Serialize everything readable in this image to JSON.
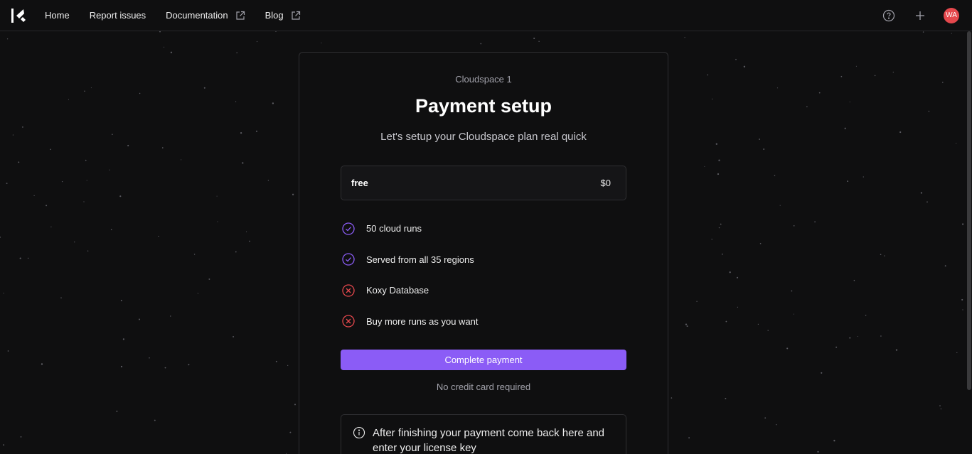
{
  "nav": {
    "logo": "koxy-logo",
    "items": [
      {
        "label": "Home",
        "external": false
      },
      {
        "label": "Report issues",
        "external": false
      },
      {
        "label": "Documentation",
        "external": true
      },
      {
        "label": "Blog",
        "external": true
      }
    ]
  },
  "toolbar": {
    "help_icon": "help-circle-icon",
    "add_icon": "plus-icon",
    "avatar_initials": "WA",
    "avatar_color": "#e5484d"
  },
  "card": {
    "workspace": "Cloudspace 1",
    "title": "Payment setup",
    "lead": "Let's setup your Cloudspace plan real quick",
    "plan": {
      "name": "free",
      "price": "$0"
    },
    "features": [
      {
        "label": "50 cloud runs",
        "included": true
      },
      {
        "label": "Served from all 35 regions",
        "included": true
      },
      {
        "label": "Koxy Database",
        "included": false
      },
      {
        "label": "Buy more runs as you want",
        "included": false
      }
    ],
    "cta_label": "Complete payment",
    "note": "No credit card required",
    "info_text": "After finishing your payment come back here and enter your license key"
  },
  "colors": {
    "background": "#0f0f10",
    "accent": "#8b5cf6",
    "included": "#8b5cf6",
    "excluded": "#e5484d"
  }
}
